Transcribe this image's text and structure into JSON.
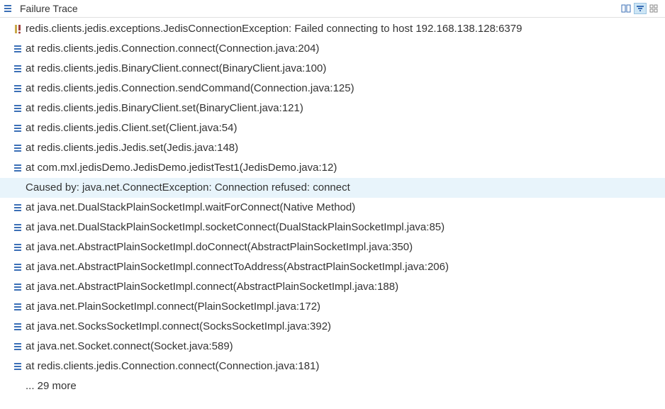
{
  "header": {
    "title": "Failure Trace"
  },
  "trace": {
    "rows": [
      {
        "icon": "exception",
        "text": "redis.clients.jedis.exceptions.JedisConnectionException: Failed connecting to host 192.168.138.128:6379",
        "highlight": false
      },
      {
        "icon": "stack",
        "text": "at redis.clients.jedis.Connection.connect(Connection.java:204)",
        "highlight": false
      },
      {
        "icon": "stack",
        "text": "at redis.clients.jedis.BinaryClient.connect(BinaryClient.java:100)",
        "highlight": false
      },
      {
        "icon": "stack",
        "text": "at redis.clients.jedis.Connection.sendCommand(Connection.java:125)",
        "highlight": false
      },
      {
        "icon": "stack",
        "text": "at redis.clients.jedis.BinaryClient.set(BinaryClient.java:121)",
        "highlight": false
      },
      {
        "icon": "stack",
        "text": "at redis.clients.jedis.Client.set(Client.java:54)",
        "highlight": false
      },
      {
        "icon": "stack",
        "text": "at redis.clients.jedis.Jedis.set(Jedis.java:148)",
        "highlight": false
      },
      {
        "icon": "stack",
        "text": "at com.mxl.jedisDemo.JedisDemo.jedistTest1(JedisDemo.java:12)",
        "highlight": false
      },
      {
        "icon": "none",
        "text": "Caused by: java.net.ConnectException: Connection refused: connect",
        "highlight": true
      },
      {
        "icon": "stack",
        "text": "at java.net.DualStackPlainSocketImpl.waitForConnect(Native Method)",
        "highlight": false
      },
      {
        "icon": "stack",
        "text": "at java.net.DualStackPlainSocketImpl.socketConnect(DualStackPlainSocketImpl.java:85)",
        "highlight": false
      },
      {
        "icon": "stack",
        "text": "at java.net.AbstractPlainSocketImpl.doConnect(AbstractPlainSocketImpl.java:350)",
        "highlight": false
      },
      {
        "icon": "stack",
        "text": "at java.net.AbstractPlainSocketImpl.connectToAddress(AbstractPlainSocketImpl.java:206)",
        "highlight": false
      },
      {
        "icon": "stack",
        "text": "at java.net.AbstractPlainSocketImpl.connect(AbstractPlainSocketImpl.java:188)",
        "highlight": false
      },
      {
        "icon": "stack",
        "text": "at java.net.PlainSocketImpl.connect(PlainSocketImpl.java:172)",
        "highlight": false
      },
      {
        "icon": "stack",
        "text": "at java.net.SocksSocketImpl.connect(SocksSocketImpl.java:392)",
        "highlight": false
      },
      {
        "icon": "stack",
        "text": "at java.net.Socket.connect(Socket.java:589)",
        "highlight": false
      },
      {
        "icon": "stack",
        "text": "at redis.clients.jedis.Connection.connect(Connection.java:181)",
        "highlight": false
      }
    ],
    "more": "... 29 more"
  }
}
